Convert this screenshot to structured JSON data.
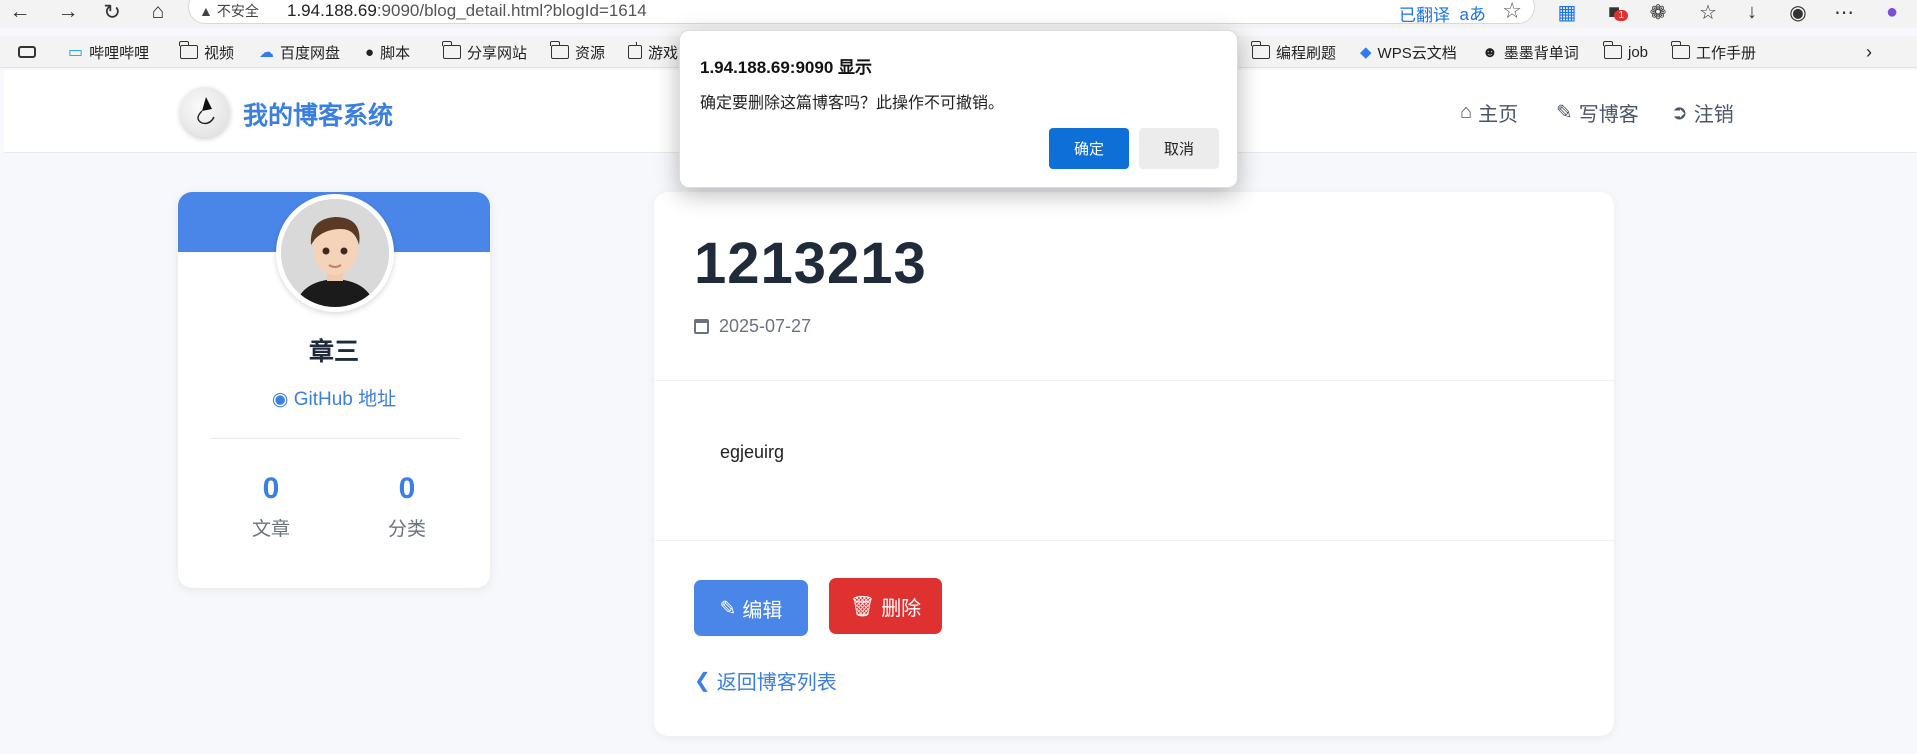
{
  "browser": {
    "security_label": "不安全",
    "url_host": "1.94.188.69",
    "url_rest": ":9090/blog_detail.html?blogId=1614",
    "translated_label": "已翻译",
    "reader_icon_text": "aあ",
    "extension_badge": "1"
  },
  "bookmarks": [
    {
      "label": "哔哩哔哩",
      "icon": "bilibili-icon"
    },
    {
      "label": "视频",
      "icon": "folder-icon"
    },
    {
      "label": "百度网盘",
      "icon": "baidu-netdisk-icon"
    },
    {
      "label": "脚本",
      "icon": "script-icon"
    },
    {
      "label": "分享网站",
      "icon": "folder-icon"
    },
    {
      "label": "资源",
      "icon": "folder-icon"
    },
    {
      "label": "游戏",
      "icon": "folder-icon"
    },
    {
      "label": "编程刷题",
      "icon": "folder-icon"
    },
    {
      "label": "WPS云文档",
      "icon": "wps-icon"
    },
    {
      "label": "墨墨背单词",
      "icon": "momo-icon"
    },
    {
      "label": "job",
      "icon": "folder-icon"
    },
    {
      "label": "工作手册",
      "icon": "folder-icon"
    }
  ],
  "site": {
    "title": "我的博客系统",
    "nav": {
      "home": "主页",
      "write": "写博客",
      "logout": "注销"
    }
  },
  "profile": {
    "name": "章三",
    "github": "GitHub 地址",
    "articles_count": "0",
    "articles_label": "文章",
    "categories_count": "0",
    "categories_label": "分类"
  },
  "blog": {
    "title": "1213213",
    "date": "2025-07-27",
    "content": "egjeuirg",
    "edit_label": "编辑",
    "delete_label": "删除",
    "back_label": "返回博客列表"
  },
  "dialog": {
    "title": "1.94.188.69:9090 显示",
    "message": "确定要删除这篇博客吗？此操作不可撤销。",
    "ok_label": "确定",
    "cancel_label": "取消"
  },
  "colors": {
    "accent": "#3b7fe0",
    "danger": "#e03131",
    "dialog_primary": "#0e6fd6"
  }
}
